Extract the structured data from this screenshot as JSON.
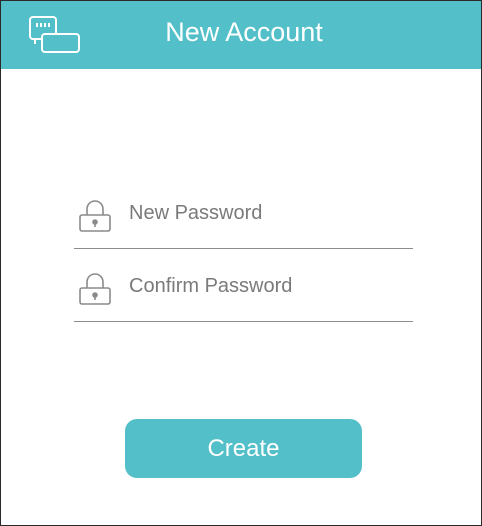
{
  "app": {
    "accent_color": "#53bfc9"
  },
  "header": {
    "title": "New Account",
    "icon": "router-device-icon"
  },
  "form": {
    "new_password": {
      "placeholder": "New Password",
      "value": "",
      "icon": "lock-icon"
    },
    "confirm_password": {
      "placeholder": "Confirm Password",
      "value": "",
      "icon": "lock-icon"
    },
    "create_label": "Create"
  }
}
